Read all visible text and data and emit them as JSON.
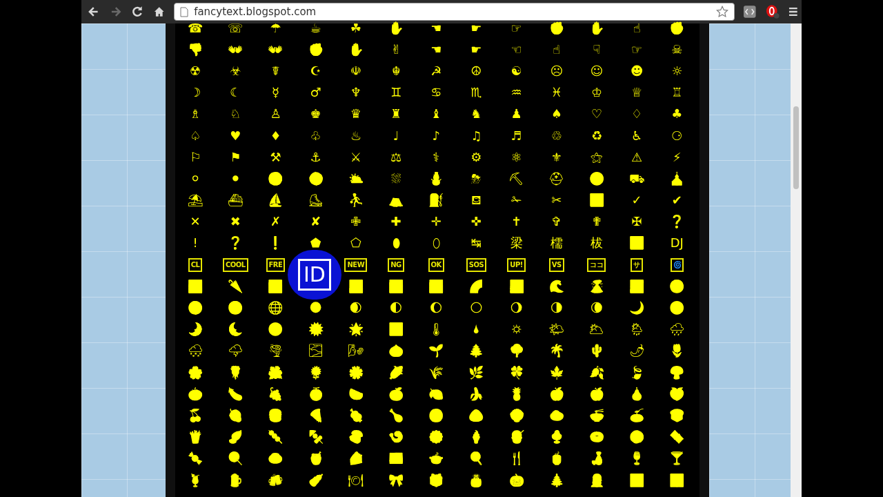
{
  "browser": {
    "url": "fancytext.blogspot.com"
  },
  "grid": {
    "rows": [
      {
        "kind": "glyph",
        "cells": [
          "☎",
          "☏",
          "☂",
          "☕",
          "☘",
          "✋",
          "☚",
          "☛",
          "☞",
          "✊",
          "✋",
          "☝",
          "✊"
        ]
      },
      {
        "kind": "glyph",
        "cells": [
          "👎",
          "👐",
          "👐",
          "✊",
          "✋",
          "✌",
          "☚",
          "☛",
          "☜",
          "☝",
          "☟",
          "☞",
          "☠"
        ]
      },
      {
        "kind": "glyph",
        "cells": [
          "☢",
          "☣",
          "☤",
          "☪",
          "☫",
          "☬",
          "☭",
          "☮",
          "☯",
          "☹",
          "☺",
          "☻",
          "☼"
        ]
      },
      {
        "kind": "glyph",
        "cells": [
          "☽",
          "☾",
          "☿",
          "♂",
          "♆",
          "♊",
          "♋",
          "♏",
          "♒",
          "♓",
          "♔",
          "♕",
          "♖"
        ]
      },
      {
        "kind": "glyph",
        "cells": [
          "♗",
          "♘",
          "♙",
          "♚",
          "♛",
          "♜",
          "♝",
          "♞",
          "♟",
          "♠",
          "♡",
          "♢",
          "♣"
        ]
      },
      {
        "kind": "glyph",
        "cells": [
          "♤",
          "♥",
          "♦",
          "♧",
          "♨",
          "♩",
          "♪",
          "♫",
          "♬",
          "♲",
          "♻",
          "♿",
          "⚆"
        ]
      },
      {
        "kind": "glyph",
        "cells": [
          "⚐",
          "⚑",
          "⚒",
          "⚓",
          "⚔",
          "⚖",
          "⚕",
          "⚙",
          "⚛",
          "⚜",
          "⚝",
          "⚠",
          "⚡"
        ]
      },
      {
        "kind": "glyph",
        "cells": [
          "⚪",
          "⚫",
          "⚽",
          "⚾",
          "⛅",
          "⛆",
          "⛄",
          "⛈",
          "⛏",
          "⛑",
          "⛔",
          "⛟",
          "⛪"
        ]
      },
      {
        "kind": "glyph",
        "cells": [
          "⛱",
          "⛴",
          "⛵",
          "⛸",
          "⛹",
          "⛺",
          "⛽",
          "⛾",
          "✁",
          "✂",
          "✅",
          "✓",
          "✔"
        ]
      },
      {
        "kind": "glyph",
        "cells": [
          "✕",
          "✖",
          "✗",
          "✘",
          "✙",
          "✚",
          "✛",
          "✜",
          "✝",
          "✞",
          "✟",
          "✠",
          "❔"
        ]
      },
      {
        "kind": "glyph",
        "cells": [
          "!",
          "❓",
          "❗",
          "⬟",
          "⬠",
          "⬮",
          "⬯",
          "↹",
          "梁",
          "檽",
          "柭",
          "🚾",
          "DJ"
        ]
      },
      {
        "kind": "boxed",
        "cells": [
          "CL",
          "COOL",
          "FRE",
          null,
          "NEW",
          "NG",
          "OK",
          "SOS",
          "UP!",
          "VS",
          "ココ",
          "サ",
          "🌀"
        ]
      },
      {
        "kind": "glyph",
        "cells": [
          "🌁",
          "🌂",
          "🌃",
          null,
          "🌅",
          "🌆",
          "🌇",
          "🌈",
          "🌉",
          "🌊",
          "🌋",
          "🌌",
          "🌍"
        ]
      },
      {
        "kind": "glyph",
        "cells": [
          "🌎",
          "🌏",
          "🌐",
          "🌑",
          "🌒",
          "🌓",
          "🌔",
          "🌕",
          "🌖",
          "🌗",
          "🌘",
          "🌙",
          "🌚"
        ]
      },
      {
        "kind": "glyph",
        "cells": [
          "🌛",
          "🌜",
          "🌝",
          "🌞",
          "🌟",
          "🌠",
          "🌡",
          "🌢",
          "🌣",
          "🌤",
          "🌥",
          "🌦",
          "🌧"
        ]
      },
      {
        "kind": "glyph",
        "cells": [
          "🌨",
          "🌩",
          "🌪",
          "🌫",
          "🌬",
          "🌰",
          "🌱",
          "🌲",
          "🌳",
          "🌴",
          "🌵",
          "🌶",
          "🌷"
        ]
      },
      {
        "kind": "glyph",
        "cells": [
          "🌸",
          "🌹",
          "🌺",
          "🌻",
          "🌼",
          "🌽",
          "🌾",
          "🌿",
          "🍀",
          "🍁",
          "🍂",
          "🍃",
          "🍄"
        ]
      },
      {
        "kind": "glyph",
        "cells": [
          "🍅",
          "🍆",
          "🍇",
          "🍈",
          "🍉",
          "🍊",
          "🍋",
          "🍌",
          "🍍",
          "🍎",
          "🍏",
          "🍐",
          "🍑"
        ]
      },
      {
        "kind": "glyph",
        "cells": [
          "🍒",
          "🍓",
          "🍔",
          "🍕",
          "🍖",
          "🍗",
          "🍘",
          "🍙",
          "🍚",
          "🍛",
          "🍜",
          "🍝",
          "🍞"
        ]
      },
      {
        "kind": "glyph",
        "cells": [
          "🍟",
          "🍠",
          "🍡",
          "🍢",
          "🍣",
          "🍤",
          "🍥",
          "🍦",
          "🍧",
          "🍨",
          "🍩",
          "🍪",
          "🍫"
        ]
      },
      {
        "kind": "glyph",
        "cells": [
          "🍬",
          "🍭",
          "🍮",
          "🍯",
          "🍰",
          "🍱",
          "🍲",
          "🍳",
          "🍴",
          "🍵",
          "🍶",
          "🍷",
          "🍸"
        ]
      },
      {
        "kind": "glyph",
        "cells": [
          "🍹",
          "🍺",
          "🍻",
          "🍼",
          "🍽",
          "🎀",
          "🎁",
          "🎂",
          "🎃",
          "🎄",
          "🎅",
          "🎆",
          "🎇"
        ]
      }
    ]
  },
  "magnifier": {
    "text": "ID"
  }
}
